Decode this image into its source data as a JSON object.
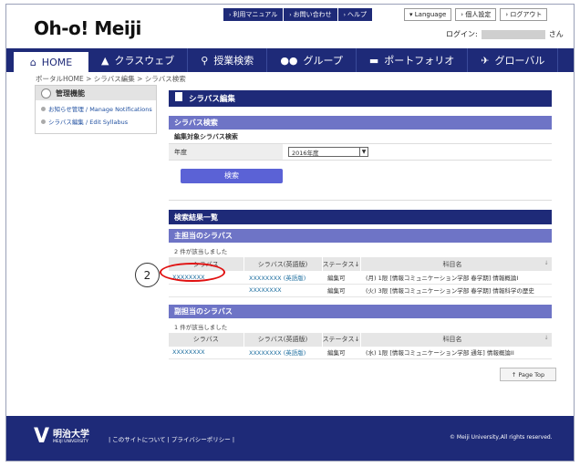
{
  "header": {
    "logo": "Oh-o! Meiji",
    "top_links": [
      "利用マニュアル",
      "お問い合わせ",
      "ヘルプ"
    ],
    "language": "Language",
    "personal_settings": "個人設定",
    "logout": "ログアウト",
    "login_label": "ログイン:",
    "login_suffix": "さん"
  },
  "nav": {
    "items": [
      {
        "label": "HOME",
        "icon": "home-icon"
      },
      {
        "label": "クラスウェブ",
        "icon": "graduation-cap-icon"
      },
      {
        "label": "授業検索",
        "icon": "search-icon"
      },
      {
        "label": "グループ",
        "icon": "users-icon"
      },
      {
        "label": "ポートフォリオ",
        "icon": "folder-icon"
      },
      {
        "label": "グローバル",
        "icon": "airplane-icon"
      }
    ]
  },
  "breadcrumb": "ポータルHOME > シラバス編集 > シラバス検索",
  "sidebar": {
    "title": "管理機能",
    "items": [
      {
        "label": "お知らせ管理 / Manage Notifications"
      },
      {
        "label": "シラバス編集 / Edit Syllabus"
      }
    ]
  },
  "main": {
    "page_title": "シラバス編集",
    "search_section": "シラバス検索",
    "form_label": "編集対象シラバス検索",
    "year_label": "年度",
    "year_value": "2016年度",
    "search_button": "検索",
    "results_title": "検索結果一覧",
    "primary": {
      "title": "主担当のシラバス",
      "count": "2 件が該当しました",
      "headers": [
        "シラバス",
        "シラバス(英語版)",
        "ステータス",
        "科目名"
      ],
      "rows": [
        {
          "syllabus": "XXXXXXXX",
          "english": "XXXXXXXX (英語版)",
          "status": "編集可",
          "course": "(月) 1限 [情報コミュニケーション学部 春学期] 情報概論I"
        },
        {
          "syllabus": "",
          "english": "XXXXXXXX",
          "status": "編集可",
          "course": "(火) 3限 [情報コミュニケーション学部 春学期] 情報科学の歴史"
        }
      ]
    },
    "secondary": {
      "title": "副担当のシラバス",
      "count": "1 件が該当しました",
      "headers": [
        "シラバス",
        "シラバス(英語版)",
        "ステータス",
        "科目名"
      ],
      "rows": [
        {
          "syllabus": "XXXXXXXX",
          "english": "XXXXXXXX (英語版)",
          "status": "編集可",
          "course": "(水) 1限 [情報コミュニケーション学部 通年] 情報概論II"
        }
      ]
    },
    "page_top": "Page Top"
  },
  "callout": {
    "number": "2"
  },
  "footer": {
    "university_jp": "明治大学",
    "university_en": "MEIJI UNIVERSITY",
    "links": "|  このサイトについて  |  プライバシーポリシー  |",
    "copyright": "© Meiji University,All rights reserved."
  }
}
